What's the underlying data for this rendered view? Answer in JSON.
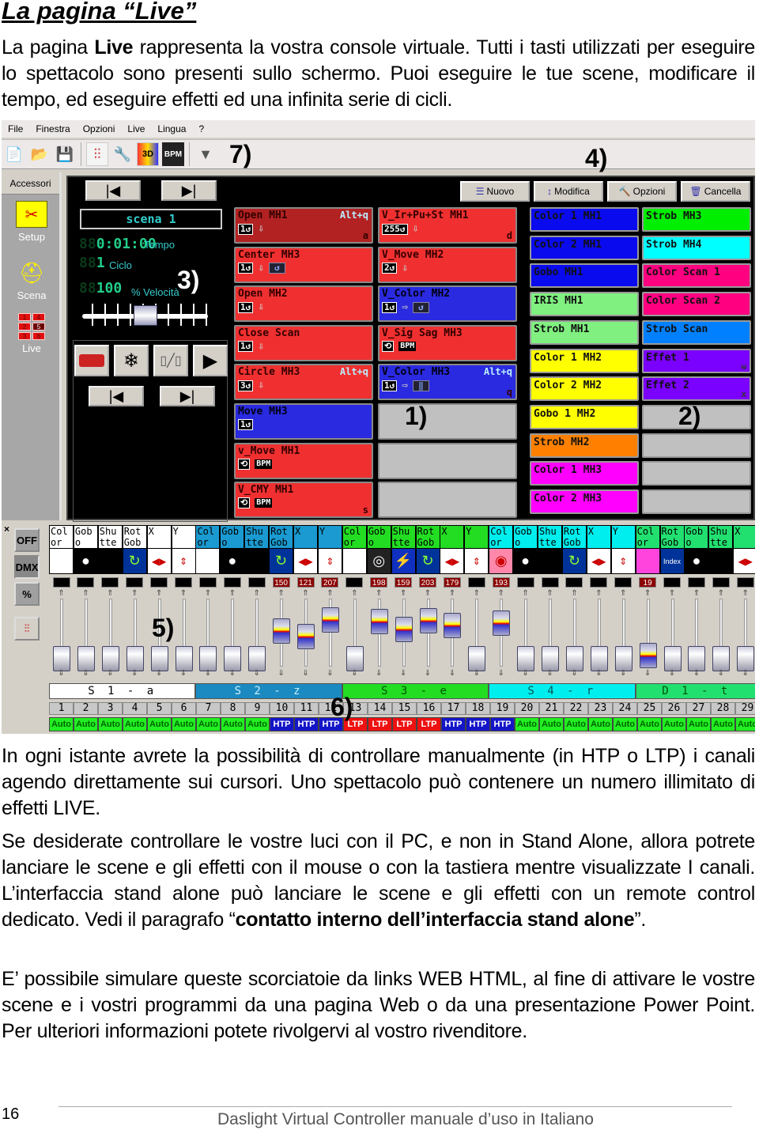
{
  "page": {
    "title": "La pagina “Live”",
    "intro_pre": "La pagina ",
    "intro_bold": "Live",
    "intro_post": " rappresenta la vostra console virtuale. Tutti i tasti utilizzati per eseguire lo spettacolo sono presenti sullo schermo. Puoi eseguire le tue scene, modificare il tempo, ed eseguire effetti ed una infinita serie di cicli.",
    "para2": "In ogni istante avrete la possibilità di controllare manualmente (in HTP o LTP) i canali agendo direttamente sui cursori. Uno spettacolo può contenere un numero illimitato di effetti LIVE.",
    "para3_pre": "Se desiderate controllare le vostre luci con il PC, e non in Stand Alone, allora potrete lanciare le scene e gli effetti con il mouse o con la tastiera mentre visualizzate I canali. L’interfaccia stand alone può lanciare le scene e gli effetti con un remote control dedicato. Vedi il paragrafo “",
    "para3_bold": "contatto interno dell’interfaccia stand alone",
    "para3_post": "”.",
    "para4": "E’ possibile simulare queste scorciatoie da links WEB HTML, al fine di attivare le vostre scene e i vostri programmi da una pagina Web o da una presentazione Power Point. Per ulteriori informazioni potete rivolgervi al vostro rivenditore.",
    "page_number": "16",
    "footer": "Daslight Virtual Controller manuale d’uso in Italiano"
  },
  "app": {
    "menu": [
      "File",
      "Finestra",
      "Opzioni",
      "Live",
      "Lingua",
      "?"
    ],
    "toolbar_icons": [
      "new-file-icon",
      "open-folder-icon",
      "save-icon",
      "faders-icon",
      "tools-icon",
      "3d-icon",
      "bpm-icon",
      "scanner-icon"
    ],
    "callouts": {
      "c1": "1)",
      "c2": "2)",
      "c3": "3)",
      "c4": "4)",
      "c5": "5)",
      "c6": "6)",
      "c7": "7)"
    },
    "sidebar": {
      "header": "Accessori",
      "items": [
        {
          "label": "Setup",
          "icon": "setup-icon"
        },
        {
          "label": "Scena",
          "icon": "scene-icon"
        },
        {
          "label": "Live",
          "icon": "live-grid-icon"
        }
      ],
      "live_grid": [
        "1",
        "4",
        "2",
        "5",
        "3",
        "6"
      ],
      "live_grid_active": "5"
    },
    "commands": [
      {
        "label": "Nuovo",
        "icon": "new-icon"
      },
      {
        "label": "Modifica",
        "icon": "edit-icon"
      },
      {
        "label": "Opzioni",
        "icon": "options-icon"
      },
      {
        "label": "Cancella",
        "icon": "delete-icon"
      }
    ],
    "scene_panel": {
      "scene_name": "scena 1",
      "time": "0:01:00",
      "time_label": "Tempo",
      "cycle": "1",
      "cycle_label": "Ciclo",
      "speed": "100",
      "speed_label": "% Velocità",
      "speed_slider_fraction": 0.5
    },
    "cues_left": [
      {
        "name": "Open MH1",
        "hotkey": "Alt+q",
        "key": "a",
        "count": "1",
        "color": "#b22222",
        "extras": [
          "down"
        ]
      },
      {
        "name": "Center MH3",
        "count": "1",
        "color": "#f03030",
        "extras": [
          "down",
          "loop"
        ]
      },
      {
        "name": "Open MH2",
        "count": "1",
        "color": "#f03030",
        "extras": [
          "down"
        ]
      },
      {
        "name": "Close Scan",
        "count": "1",
        "color": "#f03030",
        "extras": [
          "down"
        ]
      },
      {
        "name": "Circle MH3",
        "hotkey": "Alt+q",
        "count": "3",
        "color": "#f03030",
        "extras": [
          "down"
        ]
      },
      {
        "name": "Move MH3",
        "count": "1",
        "color": "#2a2ae0",
        "extras": []
      },
      {
        "name": "v_Move MH1",
        "count": "",
        "color": "#f03030",
        "extras": [
          "bpm"
        ]
      },
      {
        "name": "V_CMY MH1",
        "key": "s",
        "count": "",
        "color": "#f03030",
        "extras": [
          "bpm"
        ]
      }
    ],
    "cues_right": [
      {
        "name": "V_Ir+Pu+St MH1",
        "key": "d",
        "count": "255",
        "color": "#f03030",
        "extras": [
          "down"
        ]
      },
      {
        "name": "V_Move MH2",
        "count": "2",
        "color": "#f03030",
        "extras": [
          "down"
        ]
      },
      {
        "name": "V_Color MH2",
        "count": "1",
        "color": "#2a2ae0",
        "extras": [
          "next",
          "loop"
        ]
      },
      {
        "name": "V_Sig Sag MH3",
        "count": "",
        "color": "#f03030",
        "extras": [
          "bpm"
        ]
      },
      {
        "name": "V_Color MH3",
        "hotkey": "Alt+q",
        "key": "q",
        "count": "1",
        "color": "#2a2ae0",
        "extras": [
          "next",
          "pause"
        ]
      },
      {
        "name": "",
        "count": "",
        "color": "#c0c0c0",
        "extras": []
      },
      {
        "name": "",
        "count": "",
        "color": "#c0c0c0",
        "extras": []
      },
      {
        "name": "",
        "count": "",
        "color": "#c0c0c0",
        "extras": []
      }
    ],
    "effects_left": [
      {
        "name": "Color 1 MH1",
        "color": "#0a0aee"
      },
      {
        "name": "Color 2 MH1",
        "color": "#0a0aee"
      },
      {
        "name": "Gobo MH1",
        "color": "#0a0aee"
      },
      {
        "name": "IRIS MH1",
        "color": "#80f080"
      },
      {
        "name": "Strob MH1",
        "color": "#80f080"
      },
      {
        "name": "Color 1 MH2",
        "color": "#ffff00"
      },
      {
        "name": "Color 2 MH2",
        "color": "#ffff00"
      },
      {
        "name": "Gobo 1 MH2",
        "color": "#ffff00"
      },
      {
        "name": "Strob MH2",
        "color": "#ff8000"
      },
      {
        "name": "Color 1 MH3",
        "color": "#ff00ff"
      },
      {
        "name": "Color 2 MH3",
        "color": "#ff00ff"
      }
    ],
    "effects_right": [
      {
        "name": "Strob MH3",
        "color": "#00ee00"
      },
      {
        "name": "Strob MH4",
        "color": "#00ffff"
      },
      {
        "name": "Color Scan 1",
        "color": "#ff0080"
      },
      {
        "name": "Color Scan 2",
        "color": "#ff0080"
      },
      {
        "name": "Strob Scan",
        "color": "#0080ff"
      },
      {
        "name": "Effet 1",
        "key": "w",
        "color": "#7a00ff"
      },
      {
        "name": "Effet 2",
        "key": "x",
        "color": "#7a00ff"
      },
      {
        "name": "",
        "color": "#c0c0c0"
      },
      {
        "name": "",
        "color": "#c0c0c0"
      },
      {
        "name": "",
        "color": "#c0c0c0"
      },
      {
        "name": "",
        "color": "#c0c0c0"
      }
    ],
    "channel_modes": [
      "OFF",
      "DMX",
      "%"
    ],
    "channels": [
      {
        "n": "1",
        "head": "Col or",
        "icon": "color",
        "val": "",
        "fader": 0,
        "mode": "Auto",
        "bg": "#ffffff"
      },
      {
        "n": "2",
        "head": "Gob o",
        "icon": "gobo",
        "val": "",
        "fader": 0,
        "mode": "Auto",
        "bg": "#ffffff"
      },
      {
        "n": "3",
        "head": "Shu tte",
        "icon": "shutter",
        "val": "",
        "fader": 0,
        "mode": "Auto",
        "bg": "#ffffff"
      },
      {
        "n": "4",
        "head": "Rot Gob",
        "icon": "rotate",
        "val": "",
        "fader": 0,
        "mode": "Auto",
        "bg": "#ffffff"
      },
      {
        "n": "5",
        "head": "X",
        "icon": "pan",
        "val": "",
        "fader": 0,
        "mode": "Auto",
        "bg": "#ffffff"
      },
      {
        "n": "6",
        "head": "Y",
        "icon": "tilt",
        "val": "",
        "fader": 0,
        "mode": "Auto",
        "bg": "#ffffff"
      },
      {
        "n": "7",
        "head": "Col or",
        "icon": "color",
        "val": "",
        "fader": 0,
        "mode": "Auto",
        "bg": "#1a9ad0"
      },
      {
        "n": "8",
        "head": "Gob o",
        "icon": "gobo",
        "val": "",
        "fader": 0,
        "mode": "Auto",
        "bg": "#1a9ad0"
      },
      {
        "n": "9",
        "head": "Shu tte",
        "icon": "shutter",
        "val": "",
        "fader": 0,
        "mode": "Auto",
        "bg": "#1a9ad0"
      },
      {
        "n": "10",
        "head": "Rot Gob",
        "icon": "rotate",
        "val": "150",
        "fader": 150,
        "mode": "HTP",
        "bg": "#1a9ad0"
      },
      {
        "n": "11",
        "head": "X",
        "icon": "pan",
        "val": "121",
        "fader": 121,
        "mode": "HTP",
        "bg": "#1a9ad0"
      },
      {
        "n": "12",
        "head": "Y",
        "icon": "tilt",
        "val": "207",
        "fader": 207,
        "mode": "HTP",
        "bg": "#1a9ad0"
      },
      {
        "n": "13",
        "head": "Col or",
        "icon": "color",
        "val": "",
        "fader": 0,
        "mode": "LTP",
        "bg": "#22dd22"
      },
      {
        "n": "14",
        "head": "Gob o",
        "icon": "gobo-swirl",
        "val": "198",
        "fader": 198,
        "mode": "LTP",
        "bg": "#22dd22"
      },
      {
        "n": "15",
        "head": "Shu tte",
        "icon": "strobe",
        "val": "159",
        "fader": 159,
        "mode": "LTP",
        "bg": "#22dd22"
      },
      {
        "n": "16",
        "head": "Rot Gob",
        "icon": "rotate",
        "val": "203",
        "fader": 203,
        "mode": "LTP",
        "bg": "#22dd22"
      },
      {
        "n": "17",
        "head": "X",
        "icon": "pan",
        "val": "179",
        "fader": 179,
        "mode": "HTP",
        "bg": "#22dd22"
      },
      {
        "n": "18",
        "head": "Y",
        "icon": "tilt",
        "val": "",
        "fader": 0,
        "mode": "HTP",
        "bg": "#22dd22"
      },
      {
        "n": "19",
        "head": "Col or",
        "icon": "color-wheel",
        "val": "193",
        "fader": 193,
        "mode": "HTP",
        "bg": "#00eeee"
      },
      {
        "n": "20",
        "head": "Gob o",
        "icon": "gobo",
        "val": "",
        "fader": 0,
        "mode": "Auto",
        "bg": "#00eeee"
      },
      {
        "n": "21",
        "head": "Shu tte",
        "icon": "shutter",
        "val": "",
        "fader": 0,
        "mode": "Auto",
        "bg": "#00eeee"
      },
      {
        "n": "22",
        "head": "Rot Gob",
        "icon": "rotate",
        "val": "",
        "fader": 0,
        "mode": "Auto",
        "bg": "#00eeee"
      },
      {
        "n": "23",
        "head": "X",
        "icon": "pan",
        "val": "",
        "fader": 0,
        "mode": "Auto",
        "bg": "#00eeee"
      },
      {
        "n": "24",
        "head": "Y",
        "icon": "tilt",
        "val": "",
        "fader": 0,
        "mode": "Auto",
        "bg": "#00eeee"
      },
      {
        "n": "25",
        "head": "Col or",
        "icon": "magenta",
        "val": "19",
        "fader": 19,
        "mode": "Auto",
        "bg": "#22e070"
      },
      {
        "n": "26",
        "head": "Rot Gob",
        "icon": "index",
        "val": "",
        "fader": 0,
        "mode": "Auto",
        "bg": "#22e070"
      },
      {
        "n": "27",
        "head": "Gob o",
        "icon": "gobo",
        "val": "",
        "fader": 0,
        "mode": "Auto",
        "bg": "#22e070"
      },
      {
        "n": "28",
        "head": "Shu tte",
        "icon": "shutter",
        "val": "",
        "fader": 0,
        "mode": "Auto",
        "bg": "#22e070"
      },
      {
        "n": "29",
        "head": "X",
        "icon": "pan",
        "val": "",
        "fader": 0,
        "mode": "Auto",
        "bg": "#22e070"
      }
    ],
    "index_label": "Index",
    "fixtures": [
      {
        "label": "S 1 - a",
        "span": 6,
        "bg": "#ffffff",
        "fg": "#000"
      },
      {
        "label": "S 2 - z",
        "span": 6,
        "bg": "#1a8ac0",
        "fg": "#cef"
      },
      {
        "label": "S 3 - e",
        "span": 6,
        "bg": "#22dd22",
        "fg": "#050"
      },
      {
        "label": "S 4 - r",
        "span": 6,
        "bg": "#00eeee",
        "fg": "#055"
      },
      {
        "label": "D 1 - t",
        "span": 5,
        "bg": "#22e070",
        "fg": "#050"
      }
    ]
  }
}
